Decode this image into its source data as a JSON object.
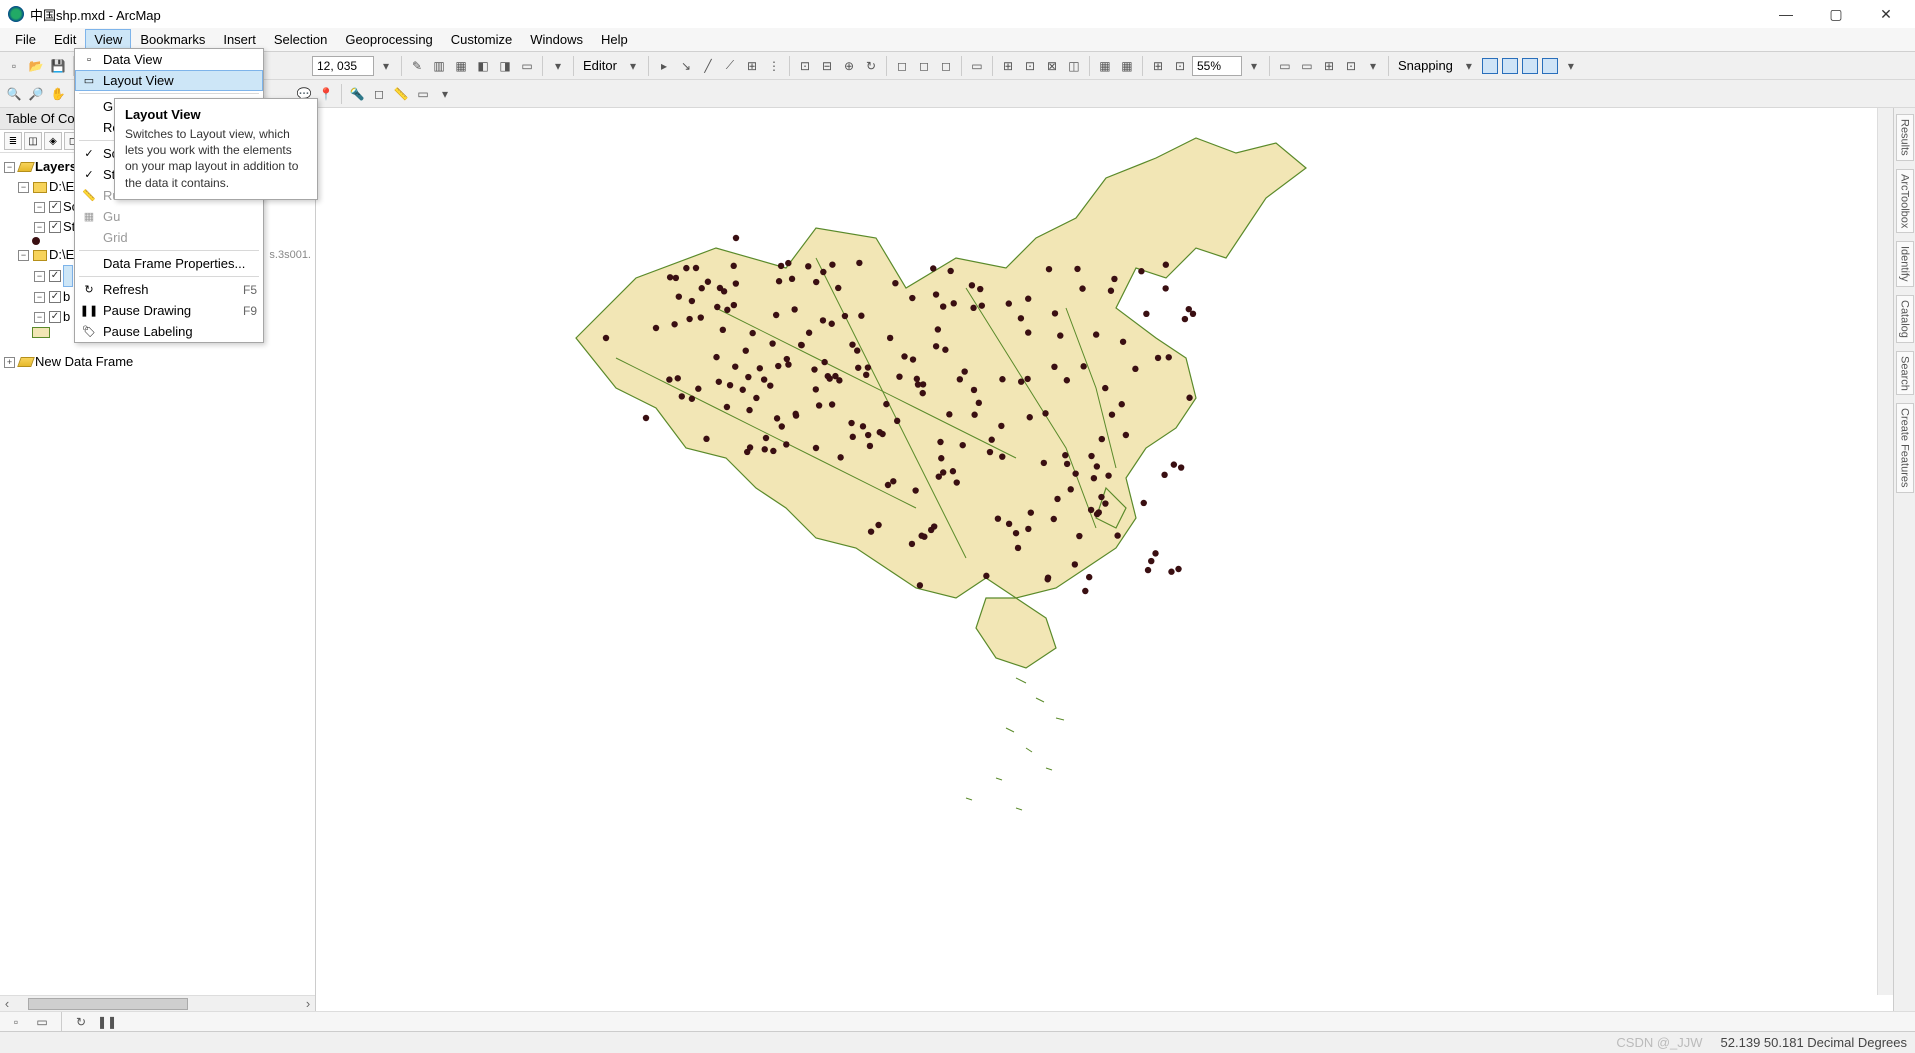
{
  "window": {
    "title": "中国shp.mxd - ArcMap"
  },
  "menubar": [
    "File",
    "Edit",
    "View",
    "Bookmarks",
    "Insert",
    "Selection",
    "Geoprocessing",
    "Customize",
    "Windows",
    "Help"
  ],
  "menubar_open_index": 2,
  "toolbar1": {
    "scale_input": "12, 035",
    "editor_label": "Editor",
    "percent": "55%",
    "snapping_label": "Snapping"
  },
  "toc": {
    "title": "Table Of Co",
    "layers_label": "Layers",
    "group1": "D:\\E",
    "layer_sc": "Sc",
    "layer_st": "St",
    "group2": "D:\\E",
    "layer_b1": "b",
    "layer_b2": "b",
    "trailing_text": "s.3s001.",
    "new_frame": "New Data Frame"
  },
  "dropdown": {
    "data_view": "Data View",
    "layout_view": "Layout View",
    "graphs": "Graphs",
    "re": "Re",
    "ru": "Ru",
    "gu": "Gu",
    "grid": "Grid",
    "dfprops": "Data Frame Properties...",
    "refresh": "Refresh",
    "refresh_key": "F5",
    "pause_draw": "Pause Drawing",
    "pause_draw_key": "F9",
    "pause_label": "Pause Labeling"
  },
  "tooltip": {
    "title": "Layout View",
    "body": "Switches to Layout view, which lets you work with the elements on your map layout in addition to the data it contains."
  },
  "sidetabs": [
    "Results",
    "ArcToolbox",
    "Identify",
    "Catalog",
    "Search",
    "Create Features"
  ],
  "status": {
    "coords": "52.139  50.181 Decimal Degrees",
    "watermark": "CSDN @_JJW"
  }
}
